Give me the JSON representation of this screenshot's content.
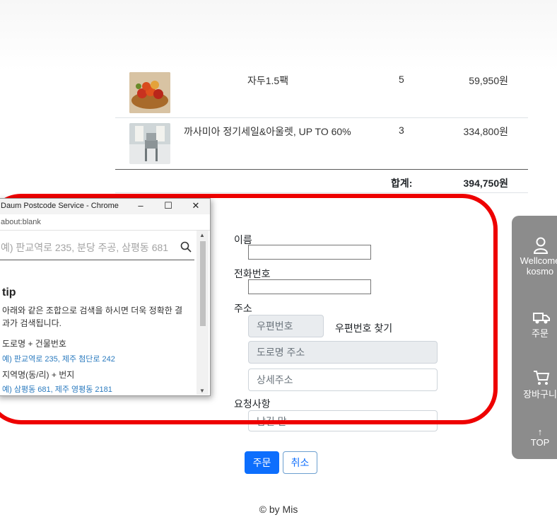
{
  "order": {
    "items": [
      {
        "name": "자두1.5팩",
        "qty": "5",
        "price": "59,950원",
        "image": "plum-bowl-photo"
      },
      {
        "name": "까사미아 정기세일&아울렛, UP TO 60%",
        "qty": "3",
        "price": "334,800원",
        "image": "chair-photo"
      }
    ],
    "total_label": "합계:",
    "total_value": "394,750원"
  },
  "form": {
    "name_label": "이름",
    "phone_label": "전화번호",
    "address_label": "주소",
    "postcode_placeholder": "우편번호",
    "postcode_button": "우편번호 찾기",
    "road_address_placeholder": "도로명 주소",
    "detail_address_placeholder": "상세주소",
    "request_label": "요청사항",
    "request_placeholder": "남길 말",
    "order_button": "주문",
    "cancel_button": "취소"
  },
  "footer": "© by Mis",
  "side_panel": {
    "welcome": "Wellcome",
    "user": "kosmo",
    "order": "주문",
    "cart": "장바구니",
    "top": "TOP"
  },
  "popup": {
    "title": "Daum Postcode Service - Chrome",
    "address": "about:blank",
    "search_placeholder": "예) 판교역로 235, 분당 주공, 삼평동 681",
    "tip_title": "tip",
    "tip_desc": "아래와 같은 조합으로 검색을 하시면 더욱 정확한 결과가 검색됩니다.",
    "ex1_title": "도로명 + 건물번호",
    "ex1_value": "예) 판교역로 235,  제주 첨단로 242",
    "ex2_title": "지역명(동/리) + 번지",
    "ex2_value": "예) 삼평동 681,  제주 영평동 2181"
  },
  "colors": {
    "annotation": "#ee0000",
    "primary": "#0d6efd",
    "side_panel": "#8c8c8c"
  }
}
